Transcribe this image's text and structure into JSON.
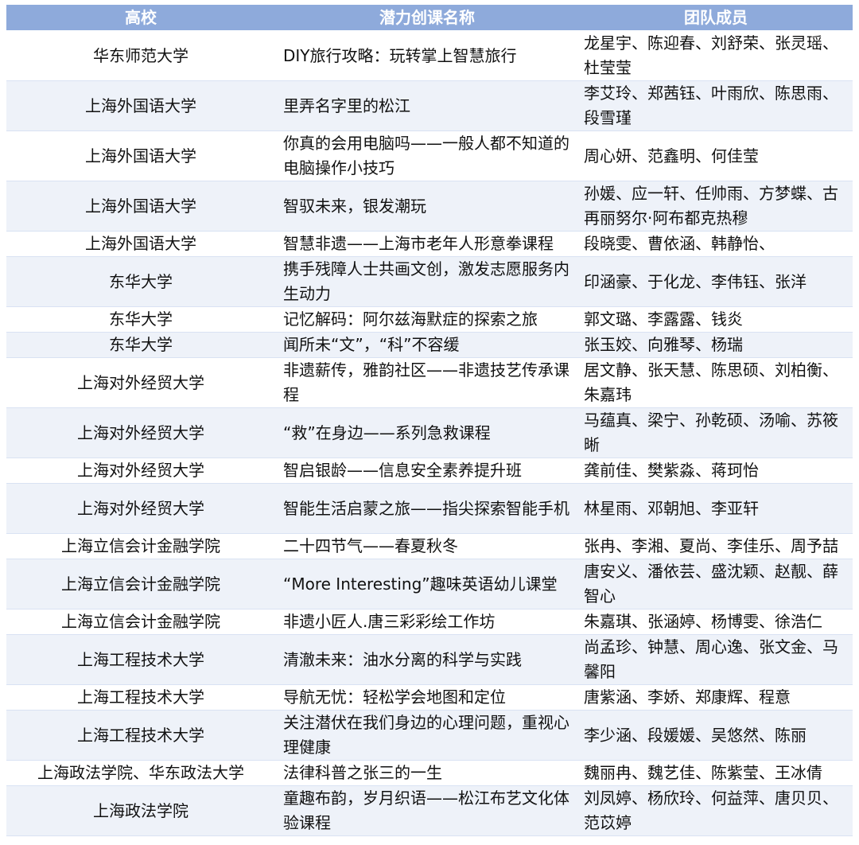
{
  "table": {
    "headers": [
      "高校",
      "潜力创课名称",
      "团队成员"
    ],
    "rows": [
      [
        "华东师范大学",
        "DIY旅行攻略：玩转掌上智慧旅行",
        "龙星宇、陈迎春、刘舒荣、张灵瑶、杜莹莹"
      ],
      [
        "上海外国语大学",
        "里弄名字里的松江",
        "李艾玲、郑茜钰、叶雨欣、陈思雨、段雪瑾"
      ],
      [
        "上海外国语大学",
        "你真的会用电脑吗——一般人都不知道的电脑操作小技巧",
        "周心妍、范鑫明、何佳莹"
      ],
      [
        "上海外国语大学",
        "智驭未来，银发潮玩",
        "孙媛、应一轩、任帅雨、方梦蝶、古再丽努尔·阿布都克热穆"
      ],
      [
        "上海外国语大学",
        "智慧非遗——上海市老年人形意拳课程",
        "段晓雯、曹依涵、韩静怡、"
      ],
      [
        "东华大学",
        "携手残障人士共画文创，激发志愿服务内生动力",
        "印涵豪、于化龙、李伟钰、张洋"
      ],
      [
        "东华大学",
        "记忆解码：阿尔兹海默症的探索之旅",
        "郭文璐、李露露、钱炎"
      ],
      [
        "东华大学",
        "闻所未“文”，“科”不容缓",
        "张玉姣、向雅琴、杨瑞"
      ],
      [
        "上海对外经贸大学",
        "非遗薪传，雅韵社区——非遗技艺传承课程",
        "居文静、张天慧、陈思硕、刘柏衡、朱嘉玮"
      ],
      [
        "上海对外经贸大学",
        "“救”在身边——系列急救课程",
        "马蕴真、梁宁、孙乾硕、汤喻、苏筱晰"
      ],
      [
        "上海对外经贸大学",
        "智启银龄——信息安全素养提升班",
        "龚前佳、樊紫淼、蒋珂怡"
      ],
      [
        "上海对外经贸大学",
        "智能生活启蒙之旅——指尖探索智能手机",
        "林星雨、邓朝旭、李亚轩"
      ],
      [
        "上海立信会计金融学院",
        "二十四节气——春夏秋冬",
        "张冉、李湘、夏尚、李佳乐、周予喆"
      ],
      [
        "上海立信会计金融学院",
        "“More Interesting”趣味英语幼儿课堂",
        "唐安义、潘依芸、盛沈颖、赵靓、薛智心"
      ],
      [
        "上海立信会计金融学院",
        "非遗小匠人.唐三彩彩绘工作坊",
        "朱嘉琪、张涵婷、杨博雯、徐浩仁"
      ],
      [
        "上海工程技术大学",
        "清澈未来：油水分离的科学与实践",
        "尚孟珍、钟慧、周心逸、张文金、马馨阳"
      ],
      [
        "上海工程技术大学",
        "导航无忧：轻松学会地图和定位",
        "唐紫涵、李娇、郑康辉、程意"
      ],
      [
        "上海工程技术大学",
        "关注潜伏在我们身边的心理问题，重视心理健康",
        "李少涵、段媛媛、吴悠然、陈丽"
      ],
      [
        "上海政法学院、华东政法大学",
        "法律科普之张三的一生",
        "魏丽冉、魏艺佳、陈紫莹、王冰倩"
      ],
      [
        "上海政法学院",
        "童趣布韵，岁月织语——松江布艺文化体验课程",
        "刘凤婷、杨欣玲、何益萍、唐贝贝、范苡婷"
      ]
    ]
  }
}
